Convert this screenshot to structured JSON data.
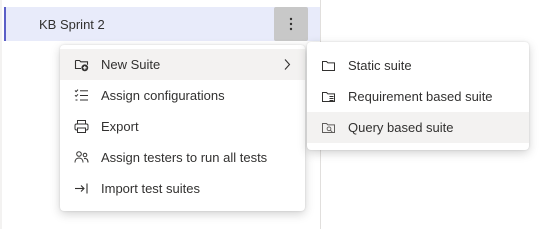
{
  "tree": {
    "selected_item": "KB Sprint 2",
    "more_button_glyph": "more-vertical-icon"
  },
  "context_menu": {
    "items": [
      {
        "label": "New Suite",
        "icon": "new-suite-icon",
        "has_submenu": true
      },
      {
        "label": "Assign configurations",
        "icon": "checklist-icon"
      },
      {
        "label": "Export",
        "icon": "printer-icon"
      },
      {
        "label": "Assign testers to run all tests",
        "icon": "people-icon"
      },
      {
        "label": "Import test suites",
        "icon": "import-arrow-icon"
      }
    ]
  },
  "submenu": {
    "items": [
      {
        "label": "Static suite",
        "icon": "folder-icon"
      },
      {
        "label": "Requirement based suite",
        "icon": "requirement-folder-icon"
      },
      {
        "label": "Query based suite",
        "icon": "query-folder-icon"
      }
    ]
  },
  "colors": {
    "selection_background": "#e8ebfa",
    "selection_accent": "#5b5fc7",
    "hover_background": "#f3f2f1",
    "text": "#323130"
  }
}
